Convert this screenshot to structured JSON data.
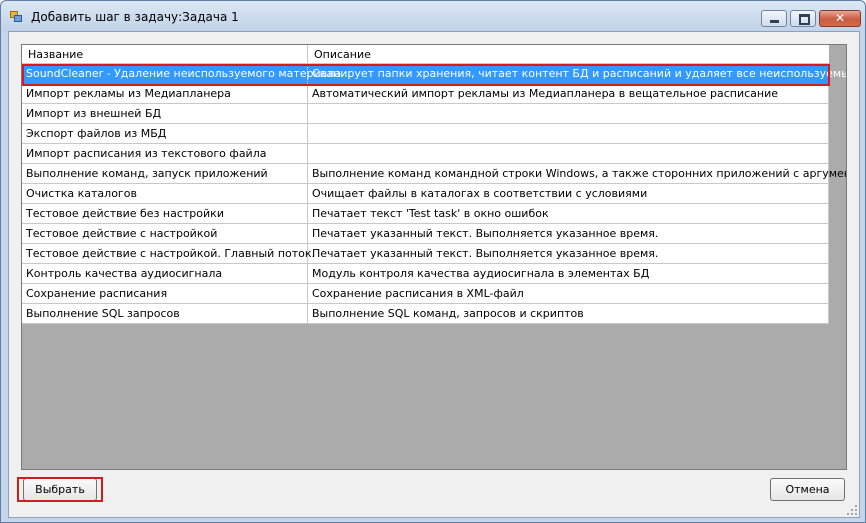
{
  "window": {
    "title": "Добавить шаг в задачу:Задача 1",
    "icon": "app-icon",
    "controls": [
      "minimize-icon",
      "maximize-icon",
      "close-icon"
    ],
    "close_glyph": "✕"
  },
  "grid": {
    "columns": [
      "Название",
      "Описание"
    ],
    "selected_index": 0,
    "rows": [
      {
        "name": "SoundCleaner - Удаление неиспользуемого материала",
        "description": "Сканирует папки хранения, читает контент БД и расписаний и удаляет все неиспользуемые файлы."
      },
      {
        "name": "Импорт рекламы из Медиапланера",
        "description": "Автоматический импорт рекламы из Медиапланера в вещательное расписание"
      },
      {
        "name": "Импорт из внешней БД",
        "description": ""
      },
      {
        "name": "Экспорт файлов из МБД",
        "description": ""
      },
      {
        "name": "Импорт расписания из текстового файла",
        "description": ""
      },
      {
        "name": "Выполнение команд, запуск приложений",
        "description": "Выполнение команд командной строки Windows, а также сторонних приложений с аргументами."
      },
      {
        "name": "Очистка каталогов",
        "description": "Очищает файлы в каталогах в соответствии с условиями"
      },
      {
        "name": "Тестовое действие без настройки",
        "description": "Печатает текст 'Test task' в окно ошибок"
      },
      {
        "name": "Тестовое действие с настройкой",
        "description": "Печатает указанный текст. Выполняется указанное время."
      },
      {
        "name": "Тестовое действие с настройкой. Главный поток.",
        "description": "Печатает указанный текст. Выполняется указанное время."
      },
      {
        "name": "Контроль качества аудиосигнала",
        "description": "Модуль контроля качества аудиосигнала в элементах БД"
      },
      {
        "name": "Сохранение расписания",
        "description": "Сохранение расписания в XML-файл"
      },
      {
        "name": "Выполнение SQL запросов",
        "description": "Выполнение SQL команд, запросов и скриптов"
      }
    ]
  },
  "buttons": {
    "select": "Выбрать",
    "cancel": "Отмена"
  },
  "colors": {
    "selection": "#3399ff",
    "highlight": "#d41c1c",
    "grid_background": "#ababab"
  }
}
